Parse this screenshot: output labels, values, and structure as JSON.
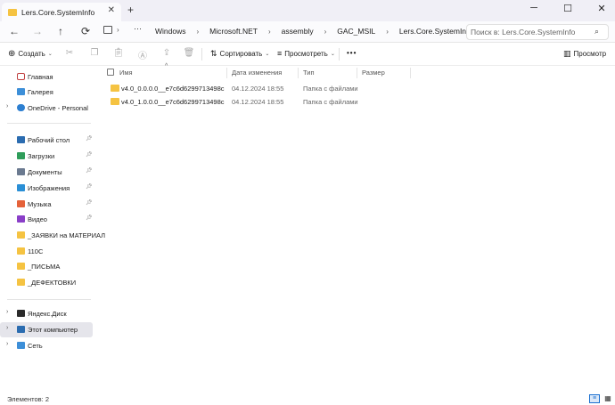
{
  "tab": {
    "title": "Lers.Core.SystemInfo"
  },
  "window": {
    "minimize": "─",
    "maximize": "☐",
    "close": "✕"
  },
  "breadcrumb": [
    "Windows",
    "Microsoft.NET",
    "assembly",
    "GAC_MSIL",
    "Lers.Core.SystemInfo"
  ],
  "search": {
    "placeholder": "Поиск в: Lers.Core.SystemInfo"
  },
  "toolbar": {
    "create": "Создать",
    "sort": "Сортировать",
    "view": "Просмотреть",
    "more": "•••",
    "preview": "Просмотр"
  },
  "sidebar": {
    "top": [
      "Главная",
      "Галерея",
      "OneDrive - Personal"
    ],
    "pinned": [
      "Рабочий стол",
      "Загрузки",
      "Документы",
      "Изображения",
      "Музыка",
      "Видео",
      "_ЗАЯВКИ на МАТЕРИАЛ",
      "110С",
      "_ПИСЬМА",
      "_ДЕФЕКТОВКИ"
    ],
    "bottom": [
      "Яндекс.Диск",
      "Этот компьютер",
      "Сеть"
    ]
  },
  "columns": {
    "name": "Имя",
    "date": "Дата изменения",
    "type": "Тип",
    "size": "Размер"
  },
  "files": [
    {
      "name": "v4.0_0.0.0.0__e7c6d6299713498c",
      "date": "04.12.2024 18:55",
      "type": "Папка с файлами"
    },
    {
      "name": "v4.0_1.0.0.0__e7c6d6299713498c",
      "date": "04.12.2024 18:55",
      "type": "Папка с файлами"
    }
  ],
  "status": {
    "count": "Элементов: 2"
  }
}
